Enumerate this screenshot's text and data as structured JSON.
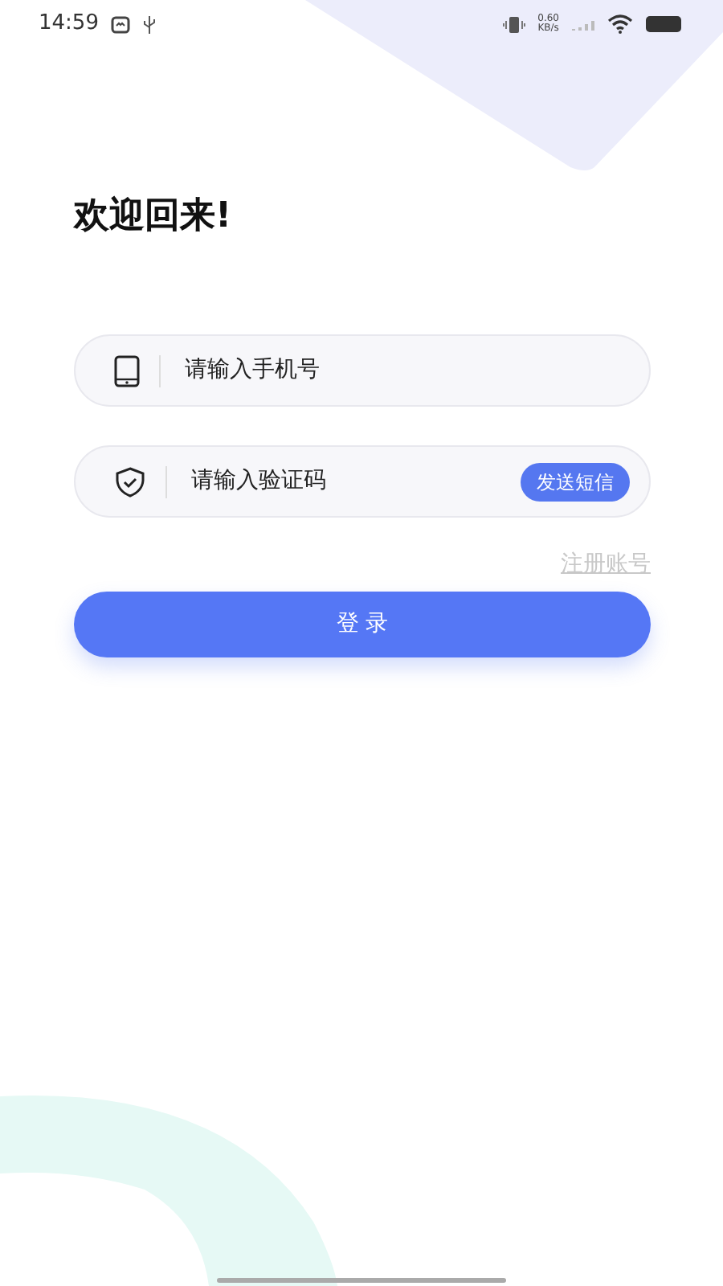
{
  "status_bar": {
    "time": "14:59",
    "net_speed": "0.60",
    "net_unit": "KB/s"
  },
  "title": "欢迎回来!",
  "fields": [
    {
      "kind": "phone",
      "placeholder": "请输入手机号"
    },
    {
      "kind": "code",
      "placeholder": "请输入验证码",
      "action": "发送短信"
    }
  ],
  "register_link": "注册账号",
  "login_button": "登 录"
}
